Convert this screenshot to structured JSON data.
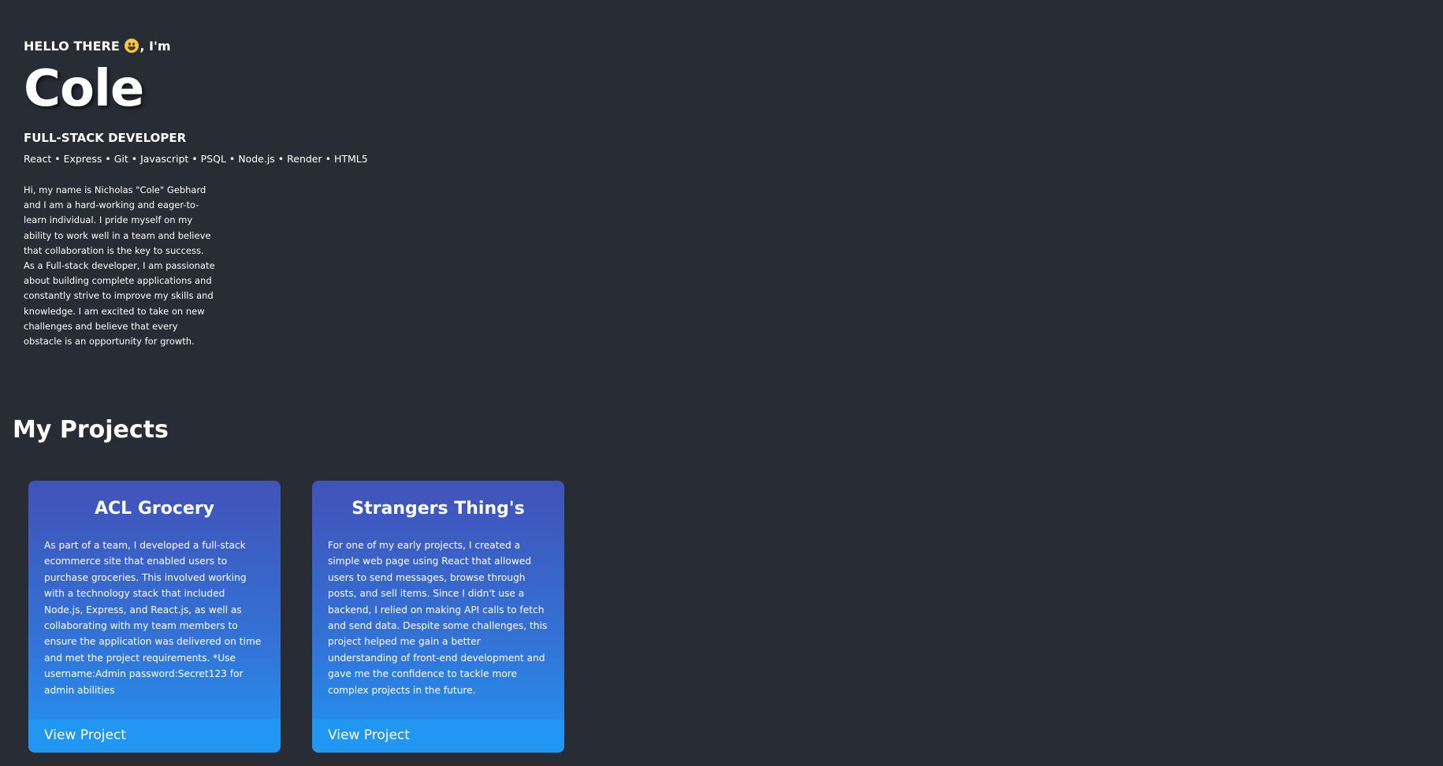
{
  "hero": {
    "greeting_prefix": "HELLO THERE",
    "greeting_suffix": ", I'm",
    "name": "Cole",
    "role": "FULL-STACK DEVELOPER",
    "skills": "React • Express • Git • Javascript • PSQL • Node.js • Render • HTML5",
    "bio": "Hi, my name is Nicholas \"Cole\" Gebhard and I am a hard-working and eager-to-learn individual. I pride myself on my ability to work well in a team and believe that collaboration is the key to success. As a Full-stack developer, I am passionate about building complete applications and constantly strive to improve my skills and knowledge. I am excited to take on new challenges and believe that every obstacle is an opportunity for growth."
  },
  "projects": {
    "title": "My Projects",
    "items": [
      {
        "title": "ACL Grocery",
        "description": "As part of a team, I developed a full-stack ecommerce site that enabled users to purchase groceries. This involved working with a technology stack that included Node.js, Express, and React.js, as well as collaborating with my team members to ensure the application was delivered on time and met the project requirements. *Use username:Admin password:Secret123 for admin abilities",
        "link_label": "View Project"
      },
      {
        "title": "Strangers Thing's",
        "description": "For one of my early projects, I created a simple web page using React that allowed users to send messages, browse through posts, and sell items. Since I didn't use a backend, I relied on making API calls to fetch and send data. Despite some challenges, this project helped me gain a better understanding of front-end development and gave me the confidence to tackle more complex projects in the future.",
        "link_label": "View Project"
      }
    ]
  },
  "colors": {
    "background": "#282c34",
    "card_gradient_top": "#4152b8",
    "card_gradient_bottom": "#2196f3"
  },
  "icons": {
    "greeting_emoji": "grinning-face-icon"
  }
}
